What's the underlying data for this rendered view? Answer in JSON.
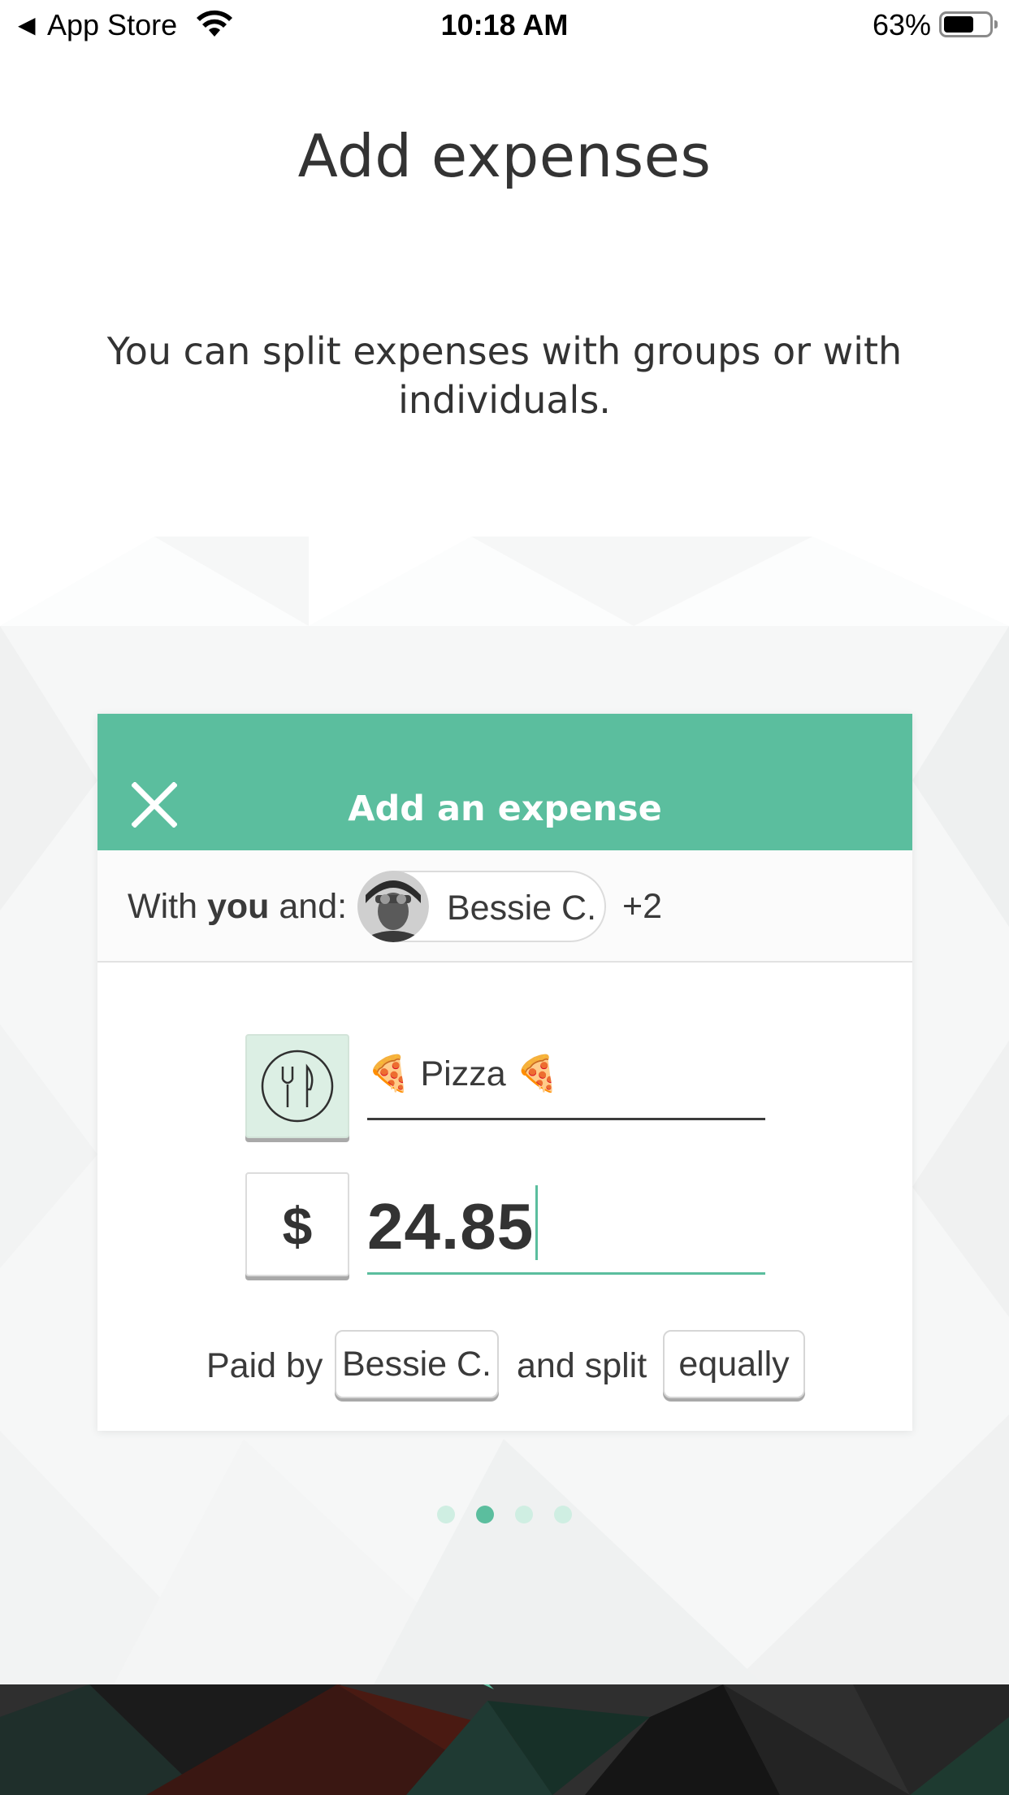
{
  "status_bar": {
    "back_label": "App Store",
    "time": "10:18 AM",
    "battery_percent": "63%",
    "battery_level": 0.63
  },
  "page": {
    "title": "Add expenses",
    "subtitle": "You can split expenses with groups or with individuals."
  },
  "card": {
    "title": "Add an expense",
    "with_prefix": "With",
    "with_you": "you",
    "with_suffix": "and:",
    "person_name": "Bessie C.",
    "extra_count": "+2",
    "description": "Pizza",
    "description_emoji": "🍕",
    "currency_symbol": "$",
    "amount": "24.85",
    "paid_by_label": "Paid by",
    "payer": "Bessie C.",
    "split_label": "and split",
    "split_mode": "equally"
  },
  "pager": {
    "total_pages": 4,
    "current_page": 2
  },
  "colors": {
    "accent": "#5bbe9e",
    "text": "#3c3c3c",
    "category_bg": "#dcefe4"
  },
  "icons": {
    "back": "back-arrow-icon",
    "wifi": "wifi-icon",
    "battery": "battery-icon",
    "close": "close-icon",
    "category": "fork-knife-icon"
  }
}
